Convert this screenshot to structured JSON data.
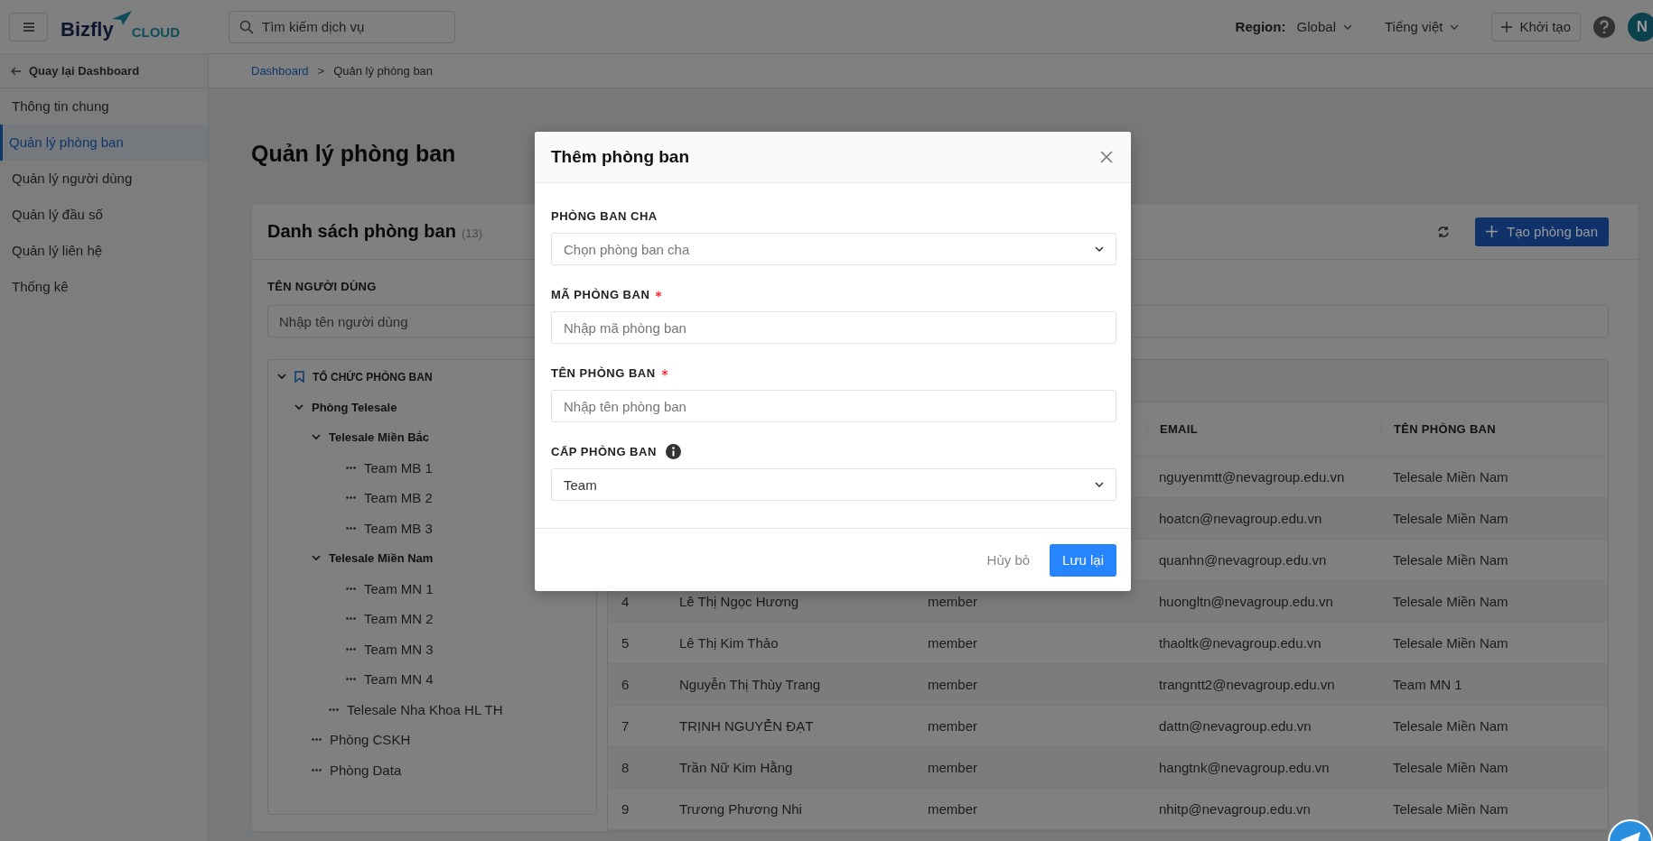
{
  "header": {
    "logo": {
      "name": "Bizfly",
      "suffix": "CLOUD"
    },
    "search": {
      "placeholder": "Tìm kiếm dịch vụ"
    },
    "region": {
      "label": "Region:",
      "value": "Global"
    },
    "language": "Tiếng việt",
    "create_button": "Khởi tạo",
    "avatar": "N"
  },
  "sidebar": {
    "back_link": "Quay lại Dashboard",
    "items": [
      {
        "label": "Thông tin chung",
        "selected": false
      },
      {
        "label": "Quản lý phòng ban",
        "selected": true
      },
      {
        "label": "Quản lý người dùng",
        "selected": false
      },
      {
        "label": "Quản lý đầu số",
        "selected": false
      },
      {
        "label": "Quản lý liên hệ",
        "selected": false
      },
      {
        "label": "Thống kê",
        "selected": false
      }
    ]
  },
  "breadcrumb": {
    "items": [
      "Dashboard",
      "Quản lý phòng ban"
    ],
    "separator": ">"
  },
  "page_title": "Quản lý phòng ban",
  "card": {
    "title": "Danh sách phòng ban",
    "count": "(13)",
    "create_button": "Tạo phòng ban",
    "filter": {
      "label": "TÊN NGƯỜI DÙNG",
      "placeholder": "Nhập tên người dùng"
    },
    "tree": {
      "nodes": [
        {
          "label": "TỔ CHỨC PHÒNG BAN",
          "expanded": true,
          "children": [
            {
              "label": "Phòng Telesale",
              "expanded": true,
              "children": [
                {
                  "label": "Telesale Miền Bắc",
                  "expanded": true,
                  "children": [
                    {
                      "label": "Team MB 1"
                    },
                    {
                      "label": "Team MB 2"
                    },
                    {
                      "label": "Team MB 3"
                    }
                  ]
                },
                {
                  "label": "Telesale Miền Nam",
                  "expanded": true,
                  "children": [
                    {
                      "label": "Team MN 1"
                    },
                    {
                      "label": "Team MN 2"
                    },
                    {
                      "label": "Team MN 3"
                    },
                    {
                      "label": "Team MN 4"
                    }
                  ]
                },
                {
                  "label": "Telesale Nha Khoa HL TH"
                }
              ]
            },
            {
              "label": "Phòng CSKH"
            },
            {
              "label": "Phòng Data"
            }
          ]
        }
      ]
    },
    "table": {
      "columns": [
        "EMAIL",
        "TÊN PHÒNG BAN"
      ],
      "rows": [
        {
          "email": "nguyenmtt@nevagroup.edu.vn",
          "department": "Telesale Miền Nam"
        },
        {
          "email": "hoatcn@nevagroup.edu.vn",
          "department": "Telesale Miền Nam"
        },
        {
          "email": "quanhn@nevagroup.edu.vn",
          "department": "Telesale Miền Nam"
        },
        {
          "index": "4",
          "name": "Lê Thị Ngọc Hương",
          "role": "member",
          "email": "huongltn@nevagroup.edu.vn",
          "department": "Telesale Miền Nam"
        },
        {
          "index": "5",
          "name": "Lê Thị Kim Thảo",
          "role": "member",
          "email": "thaoltk@nevagroup.edu.vn",
          "department": "Telesale Miền Nam"
        },
        {
          "index": "6",
          "name": "Nguyễn Thị Thùy Trang",
          "role": "member",
          "email": "trangntt2@nevagroup.edu.vn",
          "department": "Team MN 1"
        },
        {
          "index": "7",
          "name": "TRỊNH NGUYỄN ĐẠT",
          "role": "member",
          "email": "dattn@nevagroup.edu.vn",
          "department": "Telesale Miền Nam"
        },
        {
          "index": "8",
          "name": "Trần Nữ Kim Hằng",
          "role": "member",
          "email": "hangtnk@nevagroup.edu.vn",
          "department": "Telesale Miền Nam"
        },
        {
          "index": "9",
          "name": "Trương Phương Nhi",
          "role": "member",
          "email": "nhitp@nevagroup.edu.vn",
          "department": "Telesale Miền Nam"
        }
      ]
    }
  },
  "modal": {
    "title": "Thêm phòng ban",
    "fields": [
      {
        "kind": "select",
        "label": "PHÒNG BAN CHA",
        "required": false,
        "info": false,
        "placeholder": "Chọn phòng ban cha"
      },
      {
        "kind": "input",
        "label": "MÃ PHÒNG BAN",
        "required": true,
        "info": false,
        "placeholder": "Nhập mã phòng ban"
      },
      {
        "kind": "input",
        "label": "TÊN PHÒNG BAN",
        "required": true,
        "info": false,
        "placeholder": "Nhập tên phòng ban"
      },
      {
        "kind": "select",
        "label": "CẤP PHÒNG BAN",
        "required": false,
        "info": true,
        "value": "Team"
      }
    ],
    "cancel_button": "Hủy bỏ",
    "save_button": "Lưu lại"
  }
}
